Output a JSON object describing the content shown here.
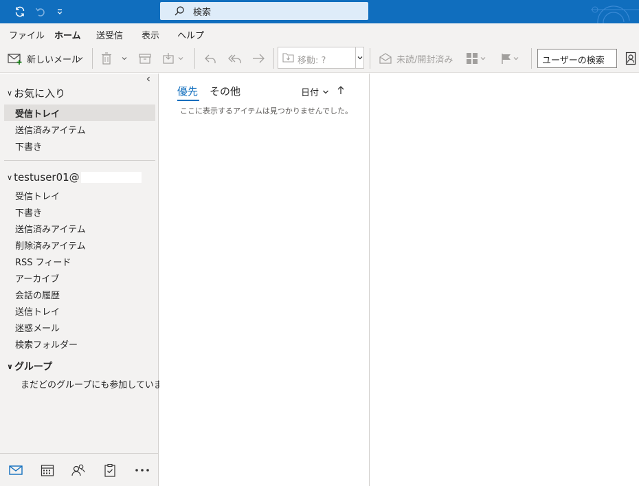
{
  "titlebar": {
    "search_placeholder": "検索",
    "icons": [
      "sync-icon",
      "undo-icon",
      "quick-access-dropdown-icon",
      "search-icon"
    ],
    "accent_color": "#106ebe"
  },
  "menu": {
    "tabs": [
      {
        "label": "ファイル",
        "active": false
      },
      {
        "label": "ホーム",
        "active": true
      },
      {
        "label": "送受信",
        "active": false
      },
      {
        "label": "表示",
        "active": false
      },
      {
        "label": "ヘルプ",
        "active": false
      }
    ]
  },
  "ribbon": {
    "new_mail_label": "新しいメール",
    "move_label": "移動: ?",
    "unread_read_label": "未読/開封済み",
    "people_search_placeholder": "ユーザーの検索",
    "icons": [
      "new-mail-icon",
      "delete-icon",
      "archive-icon",
      "move-to-icon",
      "reply-icon",
      "reply-all-icon",
      "forward-icon",
      "move-folder-icon",
      "envelope-open-icon",
      "categorize-icon",
      "flag-icon",
      "address-book-icon"
    ]
  },
  "folders": {
    "favorites_header": "お気に入り",
    "favorites": [
      {
        "label": "受信トレイ",
        "selected": true
      },
      {
        "label": "送信済みアイテム",
        "selected": false
      },
      {
        "label": "下書き",
        "selected": false
      }
    ],
    "account_header": "testuser01@",
    "account_folders": [
      {
        "label": "受信トレイ"
      },
      {
        "label": "下書き"
      },
      {
        "label": "送信済みアイテム"
      },
      {
        "label": "削除済みアイテム"
      },
      {
        "label": "RSS フィード"
      },
      {
        "label": "アーカイブ"
      },
      {
        "label": "会話の履歴"
      },
      {
        "label": "送信トレイ"
      },
      {
        "label": "迷惑メール"
      },
      {
        "label": "検索フォルダー"
      }
    ],
    "groups_header": "グループ",
    "groups_empty_text": "まだどのグループにも参加していま…",
    "bottom_nav_icons": [
      "mail-icon",
      "calendar-icon",
      "people-icon",
      "tasks-icon",
      "more-icon"
    ]
  },
  "message_list": {
    "focused_tab": "優先",
    "other_tab": "その他",
    "sort_label": "日付",
    "empty_text": "ここに表示するアイテムは見つかりませんでした。"
  }
}
